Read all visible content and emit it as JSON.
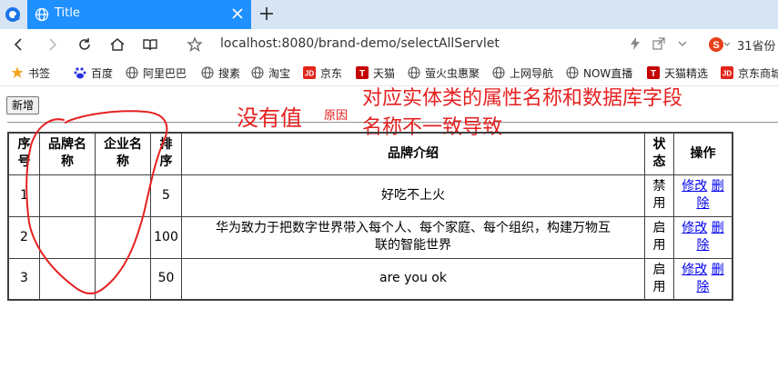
{
  "browser": {
    "tab_title": "Title",
    "address": "localhost:8080/brand-demo/selectAllServlet",
    "weather": "31省份"
  },
  "bookmarks": [
    {
      "label": "书签",
      "icon": "star-icon"
    },
    {
      "label": "百度",
      "icon": "baidu-icon"
    },
    {
      "label": "阿里巴巴",
      "icon": "globe-icon"
    },
    {
      "label": "搜素",
      "icon": "globe-icon"
    },
    {
      "label": "淘宝",
      "icon": "globe-icon"
    },
    {
      "label": "京东",
      "icon": "jd-icon"
    },
    {
      "label": "天猫",
      "icon": "tmall-icon"
    },
    {
      "label": "萤火虫惠聚",
      "icon": "globe-icon"
    },
    {
      "label": "上网导航",
      "icon": "globe-icon"
    },
    {
      "label": "NOW直播",
      "icon": "globe-icon"
    },
    {
      "label": "天猫精选",
      "icon": "tmall-icon"
    },
    {
      "label": "京东商城",
      "icon": "jd-icon"
    }
  ],
  "page": {
    "add_button": "新增",
    "annotations": {
      "no_value": "没有值",
      "reason": "原因",
      "explain_line1": "对应实体类的属性名称和数据库字段",
      "explain_line2": "名称不一致导致"
    }
  },
  "table": {
    "headers": {
      "seq": [
        "序",
        "号"
      ],
      "brand_name": [
        "品牌名",
        "称"
      ],
      "company_name": [
        "企业名",
        "称"
      ],
      "ordered": [
        "排",
        "序"
      ],
      "description": "品牌介绍",
      "status": [
        "状",
        "态"
      ],
      "action": "操作"
    },
    "rows": [
      {
        "seq": "1",
        "brand_name": "",
        "company_name": "",
        "ordered": "5",
        "description": "好吃不上火",
        "status": [
          "禁",
          "用"
        ],
        "edit": "修改",
        "delete": [
          "删",
          "除"
        ]
      },
      {
        "seq": "2",
        "brand_name": "",
        "company_name": "",
        "ordered": "100",
        "description_lines": [
          "华为致力于把数字世界带入每个人、每个家庭、每个组织，构建万物互",
          "联的智能世界"
        ],
        "status": [
          "启",
          "用"
        ],
        "edit": "修改",
        "delete": [
          "删",
          "除"
        ]
      },
      {
        "seq": "3",
        "brand_name": "",
        "company_name": "",
        "ordered": "50",
        "description": "are you ok",
        "status": [
          "启",
          "用"
        ],
        "edit": "修改",
        "delete": [
          "删",
          "除"
        ]
      }
    ]
  },
  "colors": {
    "tab_active": "#1e90ff",
    "annotation_red": "#e62020",
    "link_blue": "#0000ee"
  }
}
